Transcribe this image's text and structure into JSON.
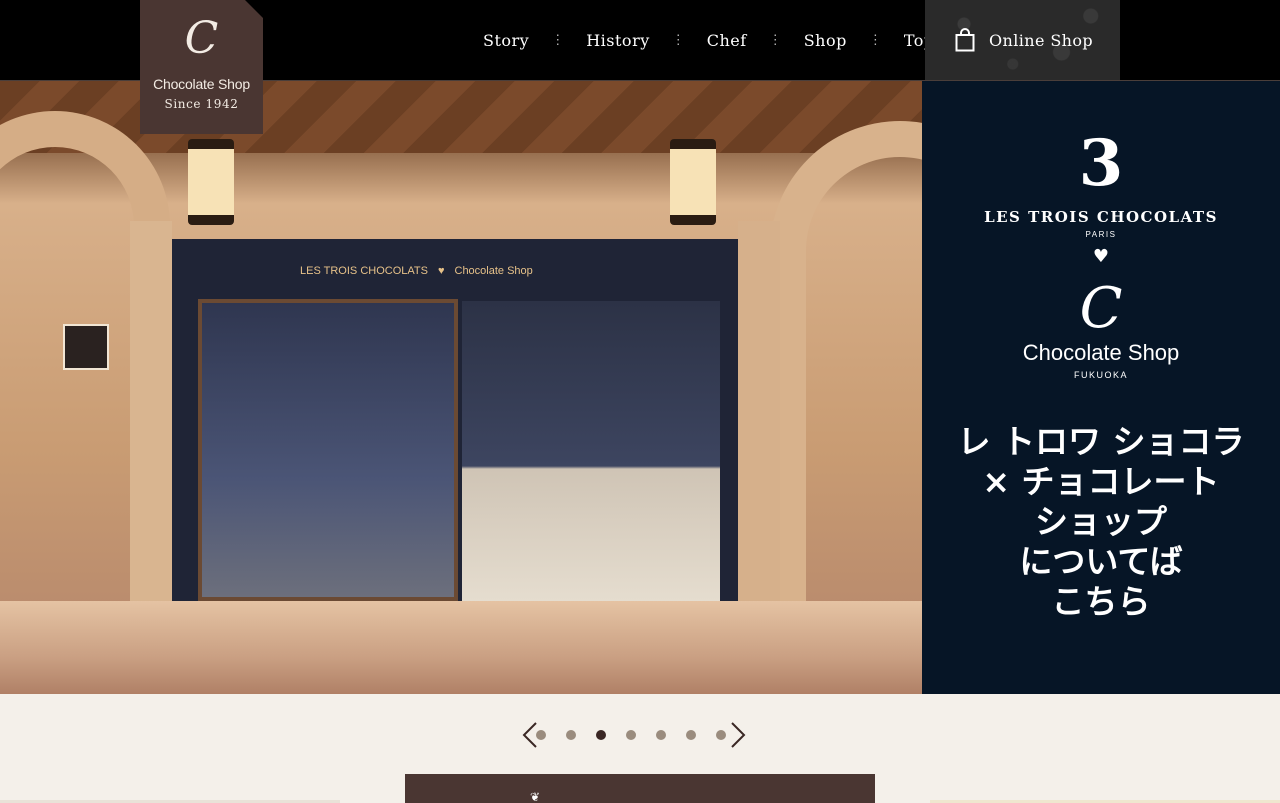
{
  "logo": {
    "mark": "C",
    "name": "Chocolate Shop",
    "since": "Since 1942"
  },
  "nav": {
    "items": [
      {
        "label": "Story"
      },
      {
        "label": "History"
      },
      {
        "label": "Chef"
      },
      {
        "label": "Shop"
      },
      {
        "label": "Topic"
      }
    ],
    "separator": "⋮"
  },
  "online_shop": {
    "label": "Online Shop",
    "icon": "shopping-bag-icon"
  },
  "hero": {
    "sign_left": "LES TROIS CHOCOLATS",
    "sign_right": "Chocolate Shop",
    "side": {
      "number": "3",
      "brand1": "LES TROIS CHOCOLATS",
      "city1": "PARIS",
      "heart": "♥",
      "mark": "C",
      "brand2": "Chocolate Shop",
      "city2": "FUKUOKA",
      "copy": [
        "レ トロワ ショコラ",
        "× チョコレート",
        "ショップ",
        "についてば",
        "こちら"
      ]
    }
  },
  "slider": {
    "prev_icon": "chevron-left-icon",
    "next_icon": "chevron-right-icon",
    "dot_count": 7,
    "active_index": 2
  },
  "colors": {
    "header_bg": "#000000",
    "logo_bg": "#4a3632",
    "side_bg": "#061526",
    "page_bg": "#f4f0ea",
    "dot_active": "#3a2724",
    "dot_inactive": "#9a8c7e"
  }
}
